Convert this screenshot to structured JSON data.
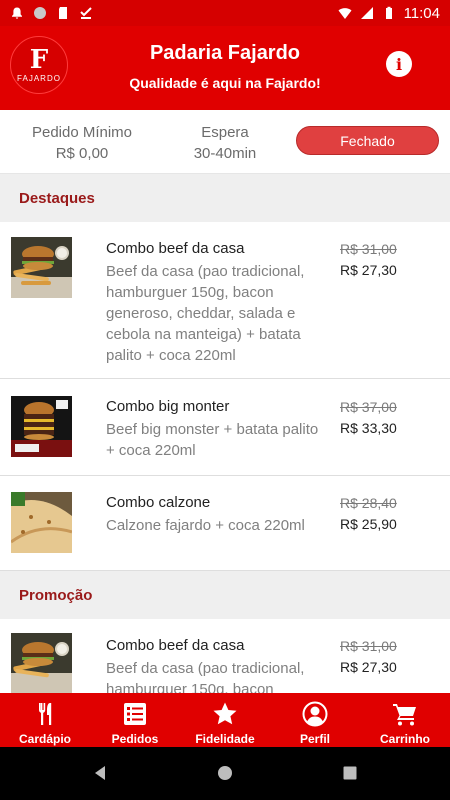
{
  "status_bar": {
    "time": "11:04",
    "icons": [
      "notification-bell-icon",
      "circle-icon",
      "sd-card-icon",
      "download-done-icon",
      "wifi-icon",
      "signal-icon",
      "battery-icon"
    ]
  },
  "header": {
    "store_name": "Padaria Fajardo",
    "tagline": "Qualidade é aqui na Fajardo!",
    "logo_mark": "F",
    "logo_word": "FAJARDO",
    "info_symbol": "i"
  },
  "info": {
    "min_order_label": "Pedido Mínimo",
    "min_order_value": "R$ 0,00",
    "wait_label": "Espera",
    "wait_value": "30-40min",
    "status": "Fechado"
  },
  "sections": [
    {
      "title": "Destaques",
      "items": [
        {
          "name": "Combo beef da casa",
          "description": "Beef da casa (pao tradicional, hamburguer 150g,  bacon generoso,  cheddar,  salada e cebola na manteiga)  + batata palito + coca 220ml",
          "old_price": "R$ 31,00",
          "price": "R$ 27,30"
        },
        {
          "name": "Combo big monter",
          "description": "Beef big monster + batata palito + coca 220ml",
          "old_price": "R$ 37,00",
          "price": "R$ 33,30"
        },
        {
          "name": "Combo calzone",
          "description": "Calzone fajardo + coca 220ml",
          "old_price": "R$ 28,40",
          "price": "R$ 25,90"
        }
      ]
    },
    {
      "title": "Promoção",
      "items": [
        {
          "name": "Combo beef da casa",
          "description": "Beef da casa (pao tradicional, hamburguer 150g,  bacon",
          "old_price": "R$ 31,00",
          "price": "R$ 27,30"
        }
      ]
    }
  ],
  "bottom_nav": [
    {
      "label": "Cardápio",
      "icon": "cutlery-icon"
    },
    {
      "label": "Pedidos",
      "icon": "list-icon"
    },
    {
      "label": "Fidelidade",
      "icon": "star-icon"
    },
    {
      "label": "Perfil",
      "icon": "person-icon"
    },
    {
      "label": "Carrinho",
      "icon": "cart-icon"
    }
  ],
  "colors": {
    "brand_red": "#e00000",
    "section_title": "#9a1a1a",
    "status_pill": "#e04040"
  }
}
